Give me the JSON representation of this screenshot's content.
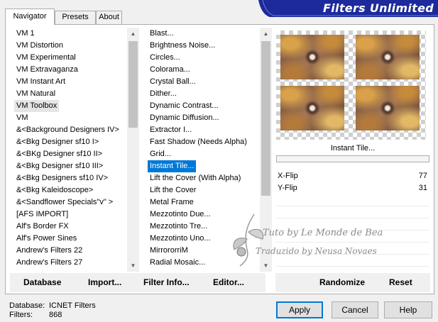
{
  "tabs": [
    "Navigator",
    "Presets",
    "About"
  ],
  "banner": {
    "title": "Filters Unlimited"
  },
  "categories": [
    "VM 1",
    "VM Distortion",
    "VM Experimental",
    "VM Extravaganza",
    "VM Instant Art",
    "VM Natural",
    "VM Toolbox",
    "VM",
    "&<Background Designers IV>",
    "&<Bkg Designer sf10 I>",
    "&<BKg Designer sf10 II>",
    "&<Bkg Designer sf10 III>",
    "&<Bkg Designers sf10 IV>",
    "&<Bkg Kaleidoscope>",
    "&<Sandflower Specials\"v\" >",
    "[AFS IMPORT]",
    "Alf's Border FX",
    "Alf's Power Sines",
    "Andrew's Filters 22",
    "Andrew's Filters 27"
  ],
  "selected_category": "VM Toolbox",
  "filters": [
    "Blast...",
    "Brightness Noise...",
    "Circles...",
    "Colorama...",
    "Crystal Ball...",
    "Dither...",
    "Dynamic Contrast...",
    "Dynamic Diffusion...",
    "Extractor I...",
    "Fast Shadow (Needs Alpha)",
    "Grid...",
    "Instant Tile...",
    "Lift the Cover (With Alpha)",
    "Lift the Cover",
    "Metal Frame",
    "Mezzotinto Due...",
    "Mezzotinto Tre...",
    "Mezzotinto Uno...",
    "MirrororriM",
    "Radial Mosaic..."
  ],
  "selected_filter": "Instant Tile...",
  "effect_name": "Instant Tile...",
  "parameters": [
    {
      "label": "X-Flip",
      "value": "77"
    },
    {
      "label": "Y-Flip",
      "value": "31"
    }
  ],
  "watermark": {
    "line1": "Tuto by Le Monde de Bea",
    "line2": "Traduzido by Neusa Novaes"
  },
  "left_buttons": {
    "database": "Database",
    "import": "Import...",
    "filter_info": "Filter Info...",
    "editor": "Editor..."
  },
  "right_buttons": {
    "randomize": "Randomize",
    "reset": "Reset"
  },
  "status": {
    "database_label": "Database:",
    "database_value": "ICNET Filters",
    "filters_label": "Filters:",
    "filters_value": "868"
  },
  "dialog_buttons": {
    "apply": "Apply",
    "cancel": "Cancel",
    "help": "Help"
  },
  "colors": {
    "selection": "#0078d7",
    "banner": "#1c2a9c",
    "panel": "#ffffff"
  },
  "icons": {
    "scroll_up": "triangle-up-icon",
    "scroll_down": "triangle-down-icon"
  }
}
